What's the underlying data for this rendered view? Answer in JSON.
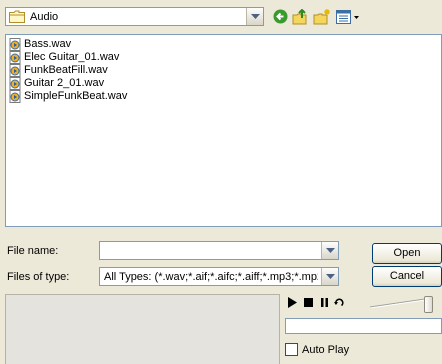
{
  "look_in": {
    "value": "Audio",
    "folder_icon": "folder-icon",
    "dropdown_icon": "chevron-down-icon"
  },
  "toolbar": {
    "back_icon": "back-arrow-icon",
    "up_icon": "up-folder-icon",
    "new_folder_icon": "new-folder-icon",
    "views_icon": "views-menu-icon"
  },
  "files": [
    {
      "name": "Bass.wav",
      "icon": "audio-file-icon"
    },
    {
      "name": "Elec Guitar_01.wav",
      "icon": "audio-file-icon"
    },
    {
      "name": "FunkBeatFill.wav",
      "icon": "audio-file-icon"
    },
    {
      "name": "Guitar 2_01.wav",
      "icon": "audio-file-icon"
    },
    {
      "name": "SimpleFunkBeat.wav",
      "icon": "audio-file-icon"
    }
  ],
  "file_name": {
    "label": "File name:",
    "value": ""
  },
  "file_type": {
    "label": "Files of type:",
    "value": "All Types: (*.wav;*.aif;*.aifc;*.aiff;*.mp3;*.mp2;*."
  },
  "buttons": {
    "open": "Open",
    "cancel": "Cancel"
  },
  "player": {
    "play_icon": "play-icon",
    "stop_icon": "stop-icon",
    "pause_icon": "pause-icon",
    "loop_icon": "loop-icon",
    "volume_level": 0.8
  },
  "autoplay": {
    "label": "Auto Play",
    "checked": false
  },
  "colors": {
    "dialog_bg": "#ece9d8",
    "field_border": "#7f9db9",
    "button_border": "#003c74",
    "accent_green": "#3a9a2c"
  }
}
